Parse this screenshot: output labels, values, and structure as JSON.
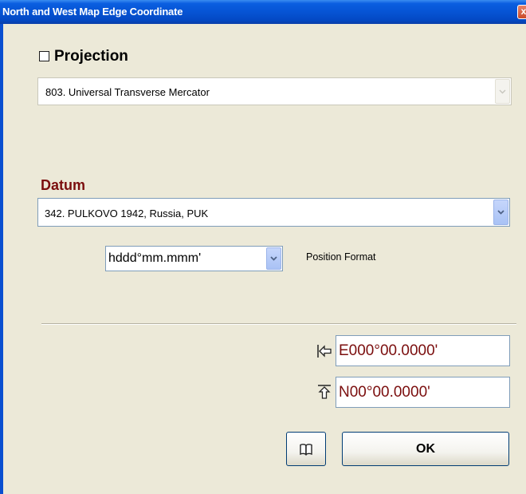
{
  "window": {
    "title": "North and West Map Edge Coordinate",
    "close_glyph": "x"
  },
  "projection": {
    "label": "Projection",
    "checked": false,
    "selected": "803. Universal Transverse Mercator",
    "enabled": false
  },
  "datum": {
    "label": "Datum",
    "selected": "342. PULKOVO 1942,  Russia,  PUK"
  },
  "position_format": {
    "selected": "hddd°mm.mmm'",
    "label": "Position Format"
  },
  "coordinates": {
    "west_value": "E000°00.0000'",
    "north_value": "N00°00.0000'",
    "west_icon": "arrow-left-to-bar-icon",
    "north_icon": "arrow-up-to-bar-icon"
  },
  "buttons": {
    "book_icon": "book-icon",
    "ok_label": "OK"
  },
  "colors": {
    "title_bar": "#0654d4",
    "background": "#ece9d8",
    "accent_text": "#7b0e0e"
  }
}
